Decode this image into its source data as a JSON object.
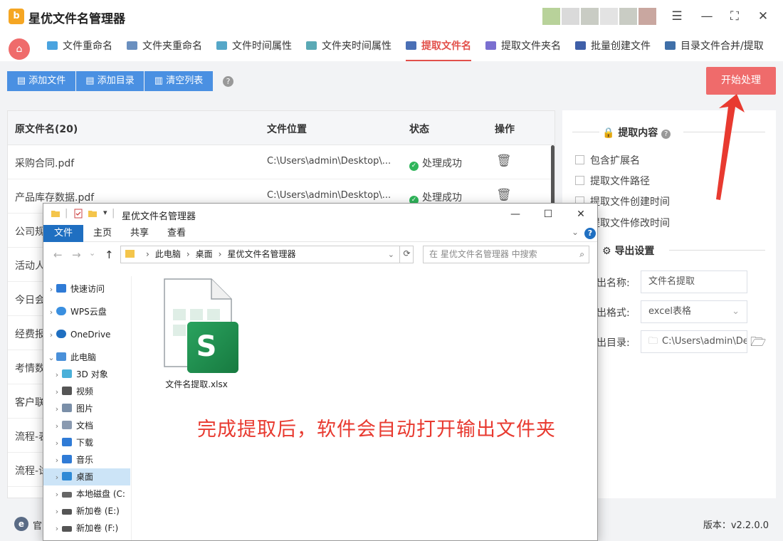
{
  "app": {
    "title": "星优文件名管理器",
    "logo_text": "b"
  },
  "tabs": [
    {
      "label": "文件重命名",
      "icon": "rename-icon",
      "color": "#4aa3df"
    },
    {
      "label": "文件夹重命名",
      "icon": "folder-rename-icon",
      "color": "#6a8fbf"
    },
    {
      "label": "文件时间属性",
      "icon": "file-time-icon",
      "color": "#55a7c8"
    },
    {
      "label": "文件夹时间属性",
      "icon": "folder-time-icon",
      "color": "#5aa9b5"
    },
    {
      "label": "提取文件名",
      "icon": "extract-filename-icon",
      "color": "#4a6fb5",
      "active": true
    },
    {
      "label": "提取文件夹名",
      "icon": "extract-folder-icon",
      "color": "#7a6fd0"
    },
    {
      "label": "批量创建文件",
      "icon": "batch-create-icon",
      "color": "#3f5fa8"
    },
    {
      "label": "目录文件合并/提取",
      "icon": "merge-icon",
      "color": "#3f6fa8"
    }
  ],
  "toolbar": {
    "add_file": "添加文件",
    "add_dir": "添加目录",
    "clear_list": "清空列表",
    "start": "开始处理"
  },
  "table": {
    "headers": {
      "name": "原文件名(20)",
      "location": "文件位置",
      "status": "状态",
      "action": "操作"
    },
    "rows": [
      {
        "name": "采购合同.pdf",
        "location": "C:\\Users\\admin\\Desktop\\...",
        "status": "处理成功"
      },
      {
        "name": "产品库存数据.pdf",
        "location": "C:\\Users\\admin\\Desktop\\...",
        "status": "处理成功"
      },
      {
        "name": "公司规"
      },
      {
        "name": "活动人"
      },
      {
        "name": "今日会"
      },
      {
        "name": "经费报"
      },
      {
        "name": "考情数"
      },
      {
        "name": "客户联"
      },
      {
        "name": "流程-表"
      },
      {
        "name": "流程-试"
      }
    ]
  },
  "settings": {
    "extract_title": "提取内容",
    "options": [
      "包含扩展名",
      "提取文件路径",
      "提取文件创建时间",
      "提取文件修改时间"
    ],
    "export_title": "导出设置",
    "name_label": "出名称:",
    "name_value": "文件名提取",
    "format_label": "出格式:",
    "format_value": "excel表格",
    "dir_label": "出目录:",
    "dir_value": "C:\\Users\\admin\\Des"
  },
  "footer": {
    "link": "官",
    "version": "版本：v2.2.0.0"
  },
  "explorer": {
    "title": "星优文件名管理器",
    "ribbon": [
      "文件",
      "主页",
      "共享",
      "查看"
    ],
    "path": [
      "此电脑",
      "桌面",
      "星优文件名管理器"
    ],
    "search_placeholder": "在 星优文件名管理器 中搜索",
    "nav": [
      {
        "label": "快速访问",
        "icon": "star-icon",
        "color": "#2f7bd6"
      },
      {
        "label": "WPS云盘",
        "icon": "cloud-icon",
        "color": "#3a8fe0"
      },
      {
        "label": "OneDrive",
        "icon": "onedrive-icon",
        "color": "#1f6fc1"
      },
      {
        "label": "此电脑",
        "icon": "computer-icon",
        "color": "#4a90d9",
        "expanded": true
      },
      {
        "label": "3D 对象",
        "icon": "cube-icon",
        "color": "#4ab0d9",
        "child": true
      },
      {
        "label": "视频",
        "icon": "video-icon",
        "color": "#555",
        "child": true
      },
      {
        "label": "图片",
        "icon": "picture-icon",
        "color": "#7a8fa8",
        "child": true
      },
      {
        "label": "文档",
        "icon": "document-icon",
        "color": "#8a9ab0",
        "child": true
      },
      {
        "label": "下载",
        "icon": "download-icon",
        "color": "#2f7bd6",
        "child": true
      },
      {
        "label": "音乐",
        "icon": "music-icon",
        "color": "#2f7bd6",
        "child": true
      },
      {
        "label": "桌面",
        "icon": "desktop-icon",
        "color": "#2f8ad6",
        "child": true,
        "selected": true
      },
      {
        "label": "本地磁盘 (C:",
        "icon": "drive-icon",
        "color": "#666",
        "child": true
      },
      {
        "label": "新加卷 (E:)",
        "icon": "drive-icon",
        "color": "#555",
        "child": true
      },
      {
        "label": "新加卷 (F:)",
        "icon": "drive-icon",
        "color": "#555",
        "child": true
      }
    ],
    "file_name": "文件名提取.xlsx",
    "file_badge": "S"
  },
  "annotation": "完成提取后，软件会自动打开输出文件夹",
  "colors": {
    "accent_red": "#ef6b6b",
    "tab_active": "#e2504a",
    "button_blue": "#4a90e2",
    "success_green": "#2fb55a",
    "excel_green": "#1e8e4e",
    "annotation_red": "#e83a30"
  }
}
